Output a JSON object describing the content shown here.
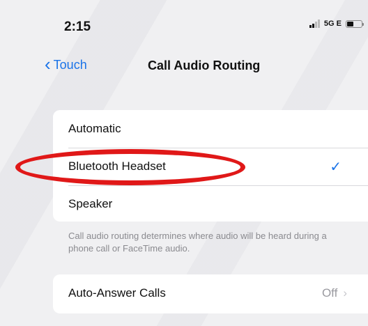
{
  "status_bar": {
    "time": "2:15",
    "network": "5G E"
  },
  "nav": {
    "back_label": "Touch",
    "title": "Call Audio Routing"
  },
  "routing_options": [
    {
      "label": "Automatic",
      "selected": false
    },
    {
      "label": "Bluetooth Headset",
      "selected": true
    },
    {
      "label": "Speaker",
      "selected": false
    }
  ],
  "checkmark": "✓",
  "footer_note": "Call audio routing determines where audio will be heard during a phone call or FaceTime audio.",
  "auto_answer": {
    "label": "Auto-Answer Calls",
    "value": "Off"
  },
  "colors": {
    "accent": "#1a73e8",
    "annotation": "#e01818",
    "background": "#f0f0f2"
  }
}
